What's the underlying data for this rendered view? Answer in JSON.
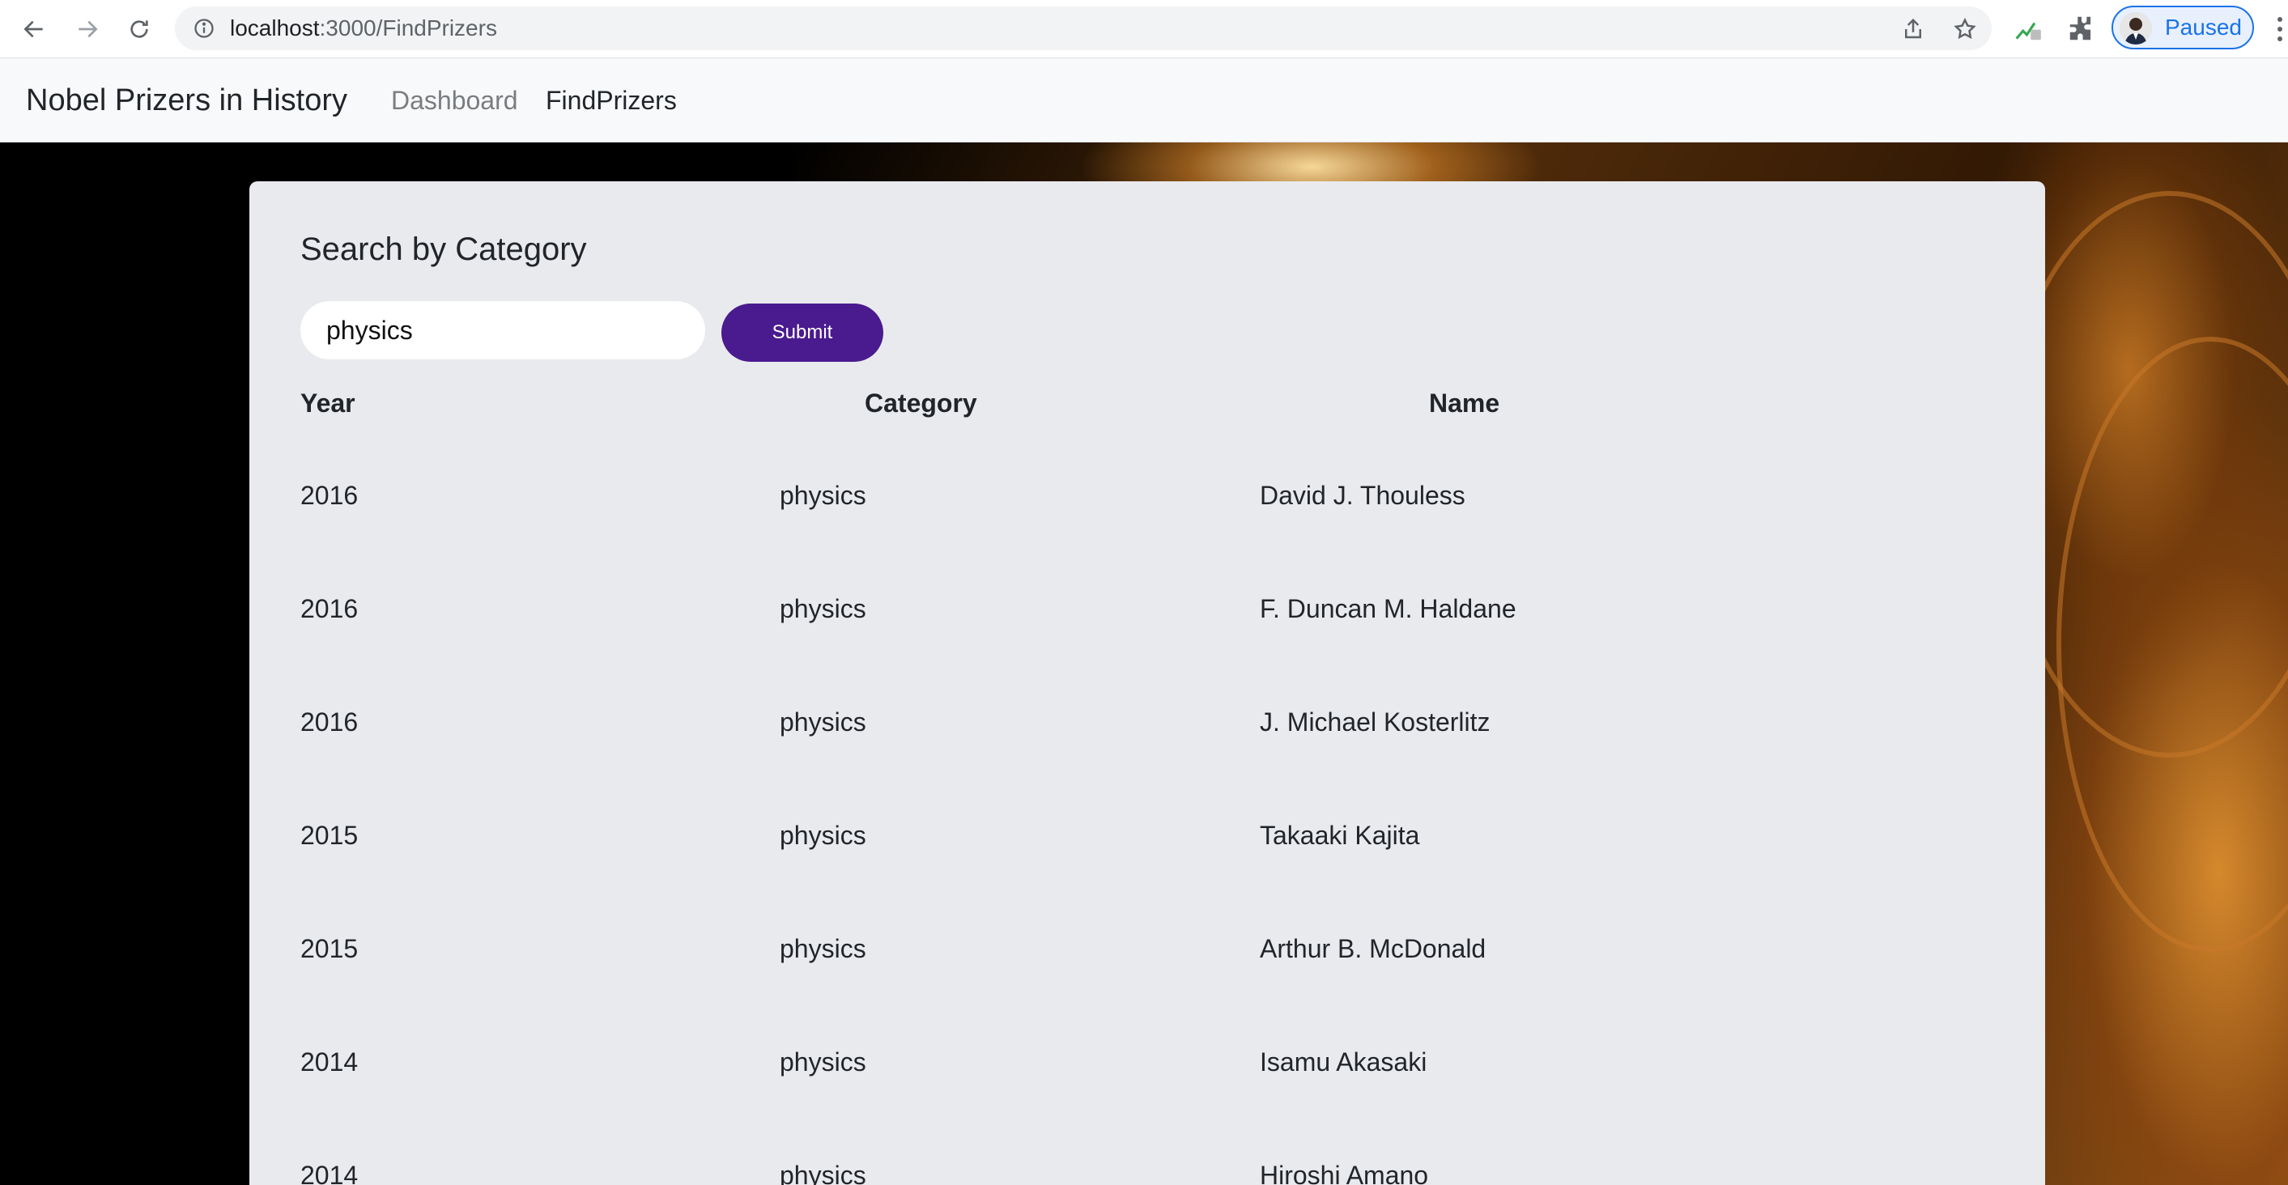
{
  "browser": {
    "url_host": "localhost",
    "url_path": ":3000/FindPrizers",
    "profile_label": "Paused"
  },
  "app": {
    "brand": "Nobel Prizers in History",
    "nav": [
      {
        "label": "Dashboard",
        "active": false
      },
      {
        "label": "FindPrizers",
        "active": true
      }
    ]
  },
  "search": {
    "title": "Search by Category",
    "input_value": "physics",
    "submit_label": "Submit"
  },
  "table": {
    "headers": [
      "Year",
      "Category",
      "Name"
    ],
    "rows": [
      {
        "year": "2016",
        "category": "physics",
        "name": "David J. Thouless"
      },
      {
        "year": "2016",
        "category": "physics",
        "name": "F. Duncan M. Haldane"
      },
      {
        "year": "2016",
        "category": "physics",
        "name": "J. Michael Kosterlitz"
      },
      {
        "year": "2015",
        "category": "physics",
        "name": "Takaaki Kajita"
      },
      {
        "year": "2015",
        "category": "physics",
        "name": "Arthur B. McDonald"
      },
      {
        "year": "2014",
        "category": "physics",
        "name": "Isamu Akasaki"
      },
      {
        "year": "2014",
        "category": "physics",
        "name": "Hiroshi Amano"
      }
    ]
  },
  "colors": {
    "submit_bg": "#4a1a8f",
    "card_bg": "#e9eaee",
    "profile_accent": "#1a73e8"
  }
}
